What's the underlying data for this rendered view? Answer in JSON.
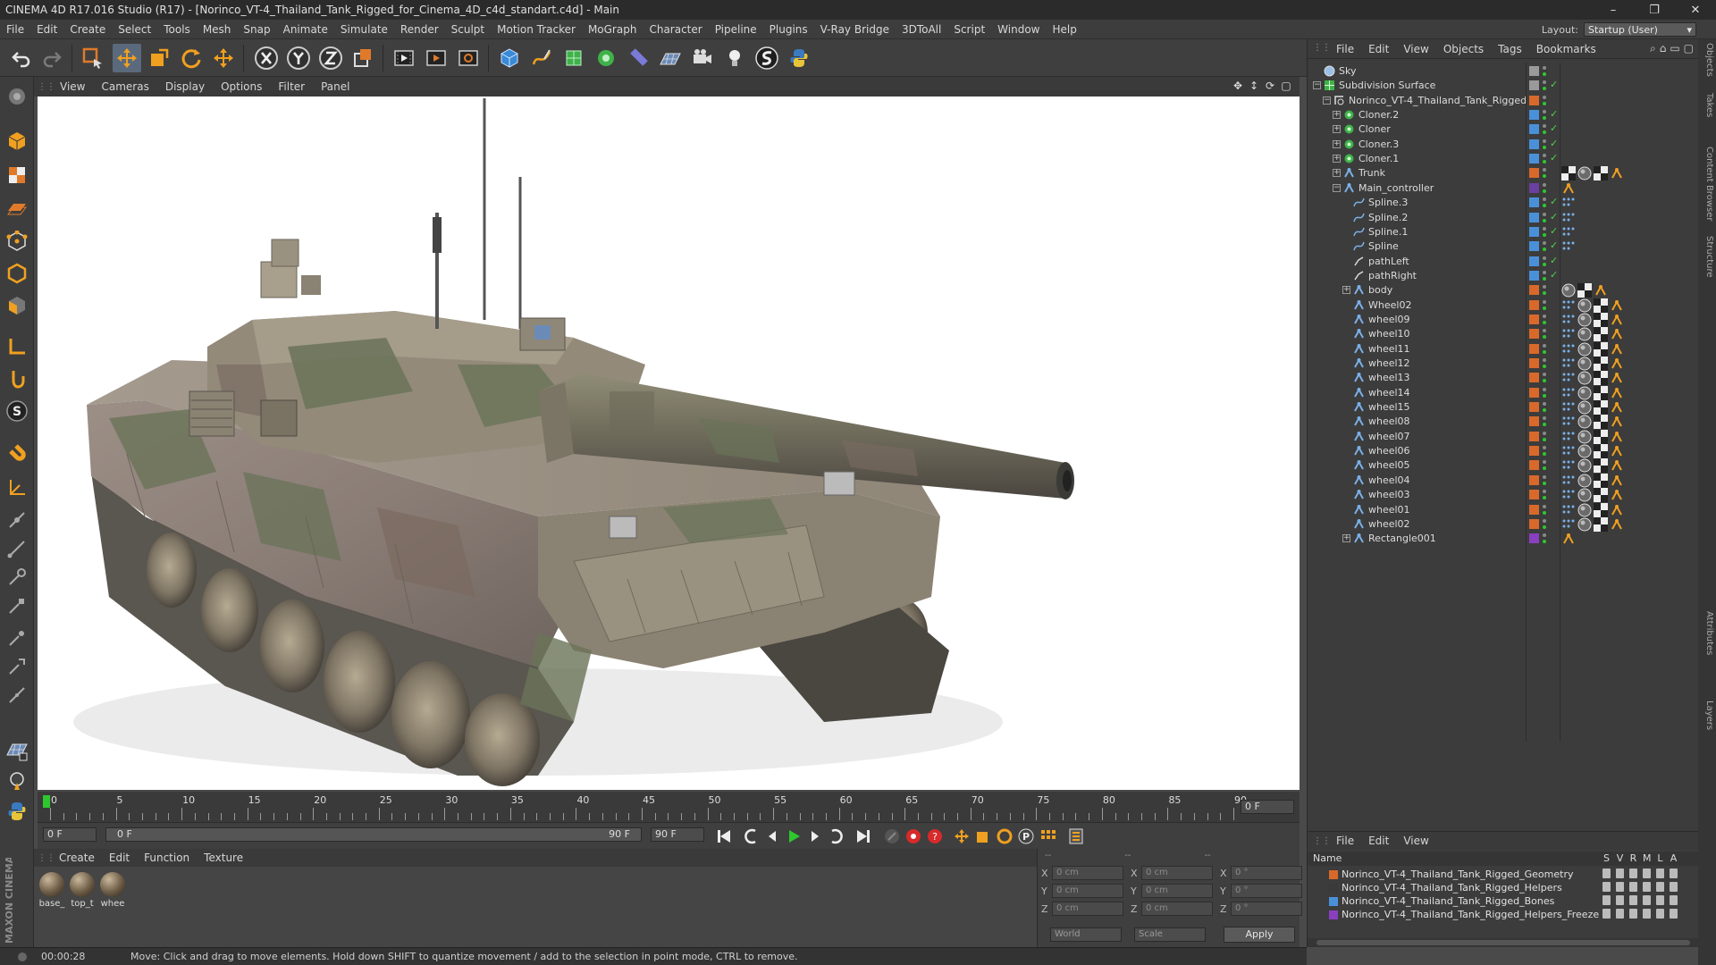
{
  "window": {
    "title": "CINEMA 4D R17.016 Studio (R17) - [Norinco_VT-4_Thailand_Tank_Rigged_for_Cinema_4D_c4d_standart.c4d] - Main",
    "buttons": [
      "–",
      "❐",
      "✕"
    ]
  },
  "menubar": {
    "items": [
      "File",
      "Edit",
      "Create",
      "Select",
      "Tools",
      "Mesh",
      "Snap",
      "Animate",
      "Simulate",
      "Render",
      "Sculpt",
      "Motion Tracker",
      "MoGraph",
      "Character",
      "Pipeline",
      "Plugins",
      "V-Ray Bridge",
      "3DToAll",
      "Script",
      "Window",
      "Help"
    ],
    "layout_label": "Layout:",
    "layout_value": "Startup (User)"
  },
  "viewport": {
    "menu": [
      "View",
      "Cameras",
      "Display",
      "Options",
      "Filter",
      "Panel"
    ]
  },
  "timeline": {
    "ticks": [
      "0",
      "5",
      "10",
      "15",
      "20",
      "25",
      "30",
      "35",
      "40",
      "45",
      "50",
      "55",
      "60",
      "65",
      "70",
      "75",
      "80",
      "85",
      "90"
    ],
    "current_frame": "0 F",
    "start_field": "0 F",
    "range_start": "0 F",
    "range_end": "90 F",
    "end_field": "90 F"
  },
  "material_manager": {
    "menu": [
      "Create",
      "Edit",
      "Function",
      "Texture"
    ],
    "materials": [
      "base_",
      "top_t",
      "whee"
    ]
  },
  "coordinates": {
    "rows": [
      {
        "axis": "X",
        "pos": "0 cm",
        "axis2": "X",
        "size": "0 cm",
        "axis3": "X",
        "rot": "0 °"
      },
      {
        "axis": "Y",
        "pos": "0 cm",
        "axis2": "Y",
        "size": "0 cm",
        "axis3": "Y",
        "rot": "0 °"
      },
      {
        "axis": "Z",
        "pos": "0 cm",
        "axis2": "Z",
        "size": "0 cm",
        "axis3": "Z",
        "rot": "0 °"
      }
    ],
    "headers": [
      "--",
      "--",
      "--"
    ],
    "mode": "World",
    "size_mode": "Scale",
    "apply": "Apply"
  },
  "status": {
    "time": "00:00:28",
    "message": "Move: Click and drag to move elements. Hold down SHIFT to quantize movement / add to the selection in point mode, CTRL to remove."
  },
  "object_manager": {
    "menu": [
      "File",
      "Edit",
      "View",
      "Objects",
      "Tags",
      "Bookmarks"
    ],
    "objects": [
      {
        "name": "Sky",
        "level": 0,
        "color": "#9a9a9a",
        "icon": "sky-icon",
        "check": false,
        "tags": []
      },
      {
        "name": "Subdivision Surface",
        "level": 0,
        "color": "#9a9a9a",
        "icon": "subdivision-icon",
        "check": true,
        "tags": []
      },
      {
        "name": "Norinco_VT-4_Thailand_Tank_Rigged",
        "level": 1,
        "color": "#d8692a",
        "icon": "null-icon",
        "check": false,
        "tags": []
      },
      {
        "name": "Cloner.2",
        "level": 2,
        "color": "#4a90d9",
        "icon": "cloner-icon",
        "check": true,
        "tags": []
      },
      {
        "name": "Cloner",
        "level": 2,
        "color": "#4a90d9",
        "icon": "cloner-icon",
        "check": true,
        "tags": []
      },
      {
        "name": "Cloner.3",
        "level": 2,
        "color": "#4a90d9",
        "icon": "cloner-icon",
        "check": true,
        "tags": []
      },
      {
        "name": "Cloner.1",
        "level": 2,
        "color": "#4a90d9",
        "icon": "cloner-icon",
        "check": true,
        "tags": []
      },
      {
        "name": "Trunk",
        "level": 2,
        "color": "#d8692a",
        "icon": "joint-icon",
        "check": false,
        "tags": [
          "checker",
          "sphere",
          "checker",
          "ik"
        ]
      },
      {
        "name": "Main_controller",
        "level": 2,
        "color": "#6a3fa0",
        "icon": "joint-icon",
        "check": false,
        "tags": [
          "ik"
        ]
      },
      {
        "name": "Spline.3",
        "level": 3,
        "color": "#4a90d9",
        "icon": "spline-icon",
        "check": true,
        "tags": [
          "dots"
        ]
      },
      {
        "name": "Spline.2",
        "level": 3,
        "color": "#4a90d9",
        "icon": "spline-icon",
        "check": true,
        "tags": [
          "dots"
        ]
      },
      {
        "name": "Spline.1",
        "level": 3,
        "color": "#4a90d9",
        "icon": "spline-icon",
        "check": true,
        "tags": [
          "dots"
        ]
      },
      {
        "name": "Spline",
        "level": 3,
        "color": "#4a90d9",
        "icon": "spline-icon",
        "check": true,
        "tags": [
          "dots"
        ]
      },
      {
        "name": "pathLeft",
        "level": 3,
        "color": "#4a90d9",
        "icon": "path-icon",
        "check": true,
        "tags": []
      },
      {
        "name": "pathRight",
        "level": 3,
        "color": "#4a90d9",
        "icon": "path-icon",
        "check": true,
        "tags": []
      },
      {
        "name": "body",
        "level": 3,
        "color": "#d8692a",
        "icon": "joint-icon",
        "check": false,
        "tags": [
          "sphere",
          "checker",
          "ik"
        ]
      },
      {
        "name": "Wheel02",
        "level": 3,
        "color": "#d8692a",
        "icon": "joint-icon",
        "check": false,
        "tags": [
          "dots",
          "sphere",
          "checker",
          "ik"
        ]
      },
      {
        "name": "wheel09",
        "level": 3,
        "color": "#d8692a",
        "icon": "joint-icon",
        "check": false,
        "tags": [
          "dots",
          "sphere",
          "checker",
          "ik"
        ]
      },
      {
        "name": "wheel10",
        "level": 3,
        "color": "#d8692a",
        "icon": "joint-icon",
        "check": false,
        "tags": [
          "dots",
          "sphere",
          "checker",
          "ik"
        ]
      },
      {
        "name": "wheel11",
        "level": 3,
        "color": "#d8692a",
        "icon": "joint-icon",
        "check": false,
        "tags": [
          "dots",
          "sphere",
          "checker",
          "ik"
        ]
      },
      {
        "name": "wheel12",
        "level": 3,
        "color": "#d8692a",
        "icon": "joint-icon",
        "check": false,
        "tags": [
          "dots",
          "sphere",
          "checker",
          "ik"
        ]
      },
      {
        "name": "wheel13",
        "level": 3,
        "color": "#d8692a",
        "icon": "joint-icon",
        "check": false,
        "tags": [
          "dots",
          "sphere",
          "checker",
          "ik"
        ]
      },
      {
        "name": "wheel14",
        "level": 3,
        "color": "#d8692a",
        "icon": "joint-icon",
        "check": false,
        "tags": [
          "dots",
          "sphere",
          "checker",
          "ik"
        ]
      },
      {
        "name": "wheel15",
        "level": 3,
        "color": "#d8692a",
        "icon": "joint-icon",
        "check": false,
        "tags": [
          "dots",
          "sphere",
          "checker",
          "ik"
        ]
      },
      {
        "name": "wheel08",
        "level": 3,
        "color": "#d8692a",
        "icon": "joint-icon",
        "check": false,
        "tags": [
          "dots",
          "sphere",
          "checker",
          "ik"
        ]
      },
      {
        "name": "wheel07",
        "level": 3,
        "color": "#d8692a",
        "icon": "joint-icon",
        "check": false,
        "tags": [
          "dots",
          "sphere",
          "checker",
          "ik"
        ]
      },
      {
        "name": "wheel06",
        "level": 3,
        "color": "#d8692a",
        "icon": "joint-icon",
        "check": false,
        "tags": [
          "dots",
          "sphere",
          "checker",
          "ik"
        ]
      },
      {
        "name": "wheel05",
        "level": 3,
        "color": "#d8692a",
        "icon": "joint-icon",
        "check": false,
        "tags": [
          "dots",
          "sphere",
          "checker",
          "ik"
        ]
      },
      {
        "name": "wheel04",
        "level": 3,
        "color": "#d8692a",
        "icon": "joint-icon",
        "check": false,
        "tags": [
          "dots",
          "sphere",
          "checker",
          "ik"
        ]
      },
      {
        "name": "wheel03",
        "level": 3,
        "color": "#d8692a",
        "icon": "joint-icon",
        "check": false,
        "tags": [
          "dots",
          "sphere",
          "checker",
          "ik"
        ]
      },
      {
        "name": "wheel01",
        "level": 3,
        "color": "#d8692a",
        "icon": "joint-icon",
        "check": false,
        "tags": [
          "dots",
          "sphere",
          "checker",
          "ik"
        ]
      },
      {
        "name": "wheel02",
        "level": 3,
        "color": "#d8692a",
        "icon": "joint-icon",
        "check": false,
        "tags": [
          "dots",
          "sphere",
          "checker",
          "ik"
        ]
      },
      {
        "name": "Rectangle001",
        "level": 3,
        "color": "#8a3fc0",
        "icon": "joint-icon",
        "check": false,
        "tags": [
          "ik"
        ]
      }
    ]
  },
  "layer_manager": {
    "menu": [
      "File",
      "Edit",
      "View"
    ],
    "header": {
      "name": "Name",
      "cols": [
        "S",
        "V",
        "R",
        "M",
        "L",
        "A"
      ]
    },
    "layers": [
      {
        "name": "Norinco_VT-4_Thailand_Tank_Rigged_Geometry",
        "color": "#d8692a"
      },
      {
        "name": "Norinco_VT-4_Thailand_Tank_Rigged_Helpers",
        "color": "#3a3a3a"
      },
      {
        "name": "Norinco_VT-4_Thailand_Tank_Rigged_Bones",
        "color": "#4a90d9"
      },
      {
        "name": "Norinco_VT-4_Thailand_Tank_Rigged_Helpers_Freeze",
        "color": "#8a3fc0"
      }
    ]
  },
  "side_tabs": [
    "Objects",
    "Takes",
    "Content Browser",
    "Structure",
    "Attributes",
    "Layers"
  ],
  "brand": "MAXON CINEMA 4D"
}
